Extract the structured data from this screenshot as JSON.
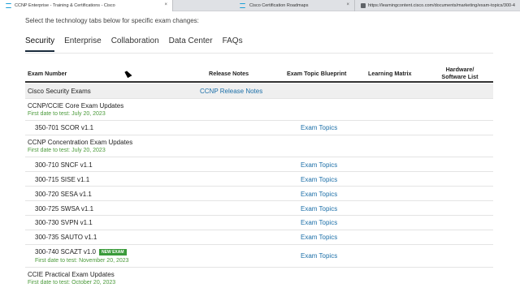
{
  "browser": {
    "tabs": [
      {
        "title": "CCNP Enterprise - Training & Certifications - Cisco",
        "active": true
      },
      {
        "title": "Cisco Certification Roadmaps",
        "active": false
      },
      {
        "title": "https://learningcontent.cisco.com/documents/marketing/exam-topics/300-4",
        "active": false
      }
    ]
  },
  "intro": "Select the technology tabs below for specific exam changes:",
  "tech_tabs": [
    "Security",
    "Enterprise",
    "Collaboration",
    "Data Center",
    "FAQs"
  ],
  "table": {
    "headers": {
      "exam_number": "Exam Number",
      "release_notes": "Release Notes",
      "blueprint": "Exam Topic Blueprint",
      "learning_matrix": "Learning Matrix",
      "hardware_line1": "Hardware/",
      "hardware_line2": "Software List"
    },
    "rows": [
      {
        "label": "Cisco Security Exams",
        "release": "CCNP Release Notes"
      },
      {
        "label": "CCNP/CCIE Core Exam Updates",
        "sub": "First date to test: July 20, 2023"
      },
      {
        "label": "350-701 SCOR v1.1",
        "topics": "Exam Topics"
      },
      {
        "label": "CCNP Concentration Exam Updates",
        "sub": "First date to test: July 20, 2023"
      },
      {
        "label": "300-710 SNCF v1.1",
        "topics": "Exam Topics"
      },
      {
        "label": "300-715 SISE v1.1",
        "topics": "Exam Topics"
      },
      {
        "label": "300-720 SESA v1.1",
        "topics": "Exam Topics"
      },
      {
        "label": "300-725 SWSA v1.1",
        "topics": "Exam Topics"
      },
      {
        "label": "300-730 SVPN v1.1",
        "topics": "Exam Topics"
      },
      {
        "label": "300-735 SAUTO v1.1",
        "topics": "Exam Topics"
      },
      {
        "label": "300-740 SCAZT v1.0",
        "badge": "NEW EXAM",
        "sub": "First date to test: November 20, 2023",
        "topics": "Exam Topics"
      },
      {
        "label": "CCIE Practical Exam Updates",
        "sub": "First date to test: October 20, 2023"
      }
    ]
  },
  "colors": {
    "link": "#1c6fa8",
    "green": "#4a9a3a",
    "badge": "#3a9b3a"
  }
}
